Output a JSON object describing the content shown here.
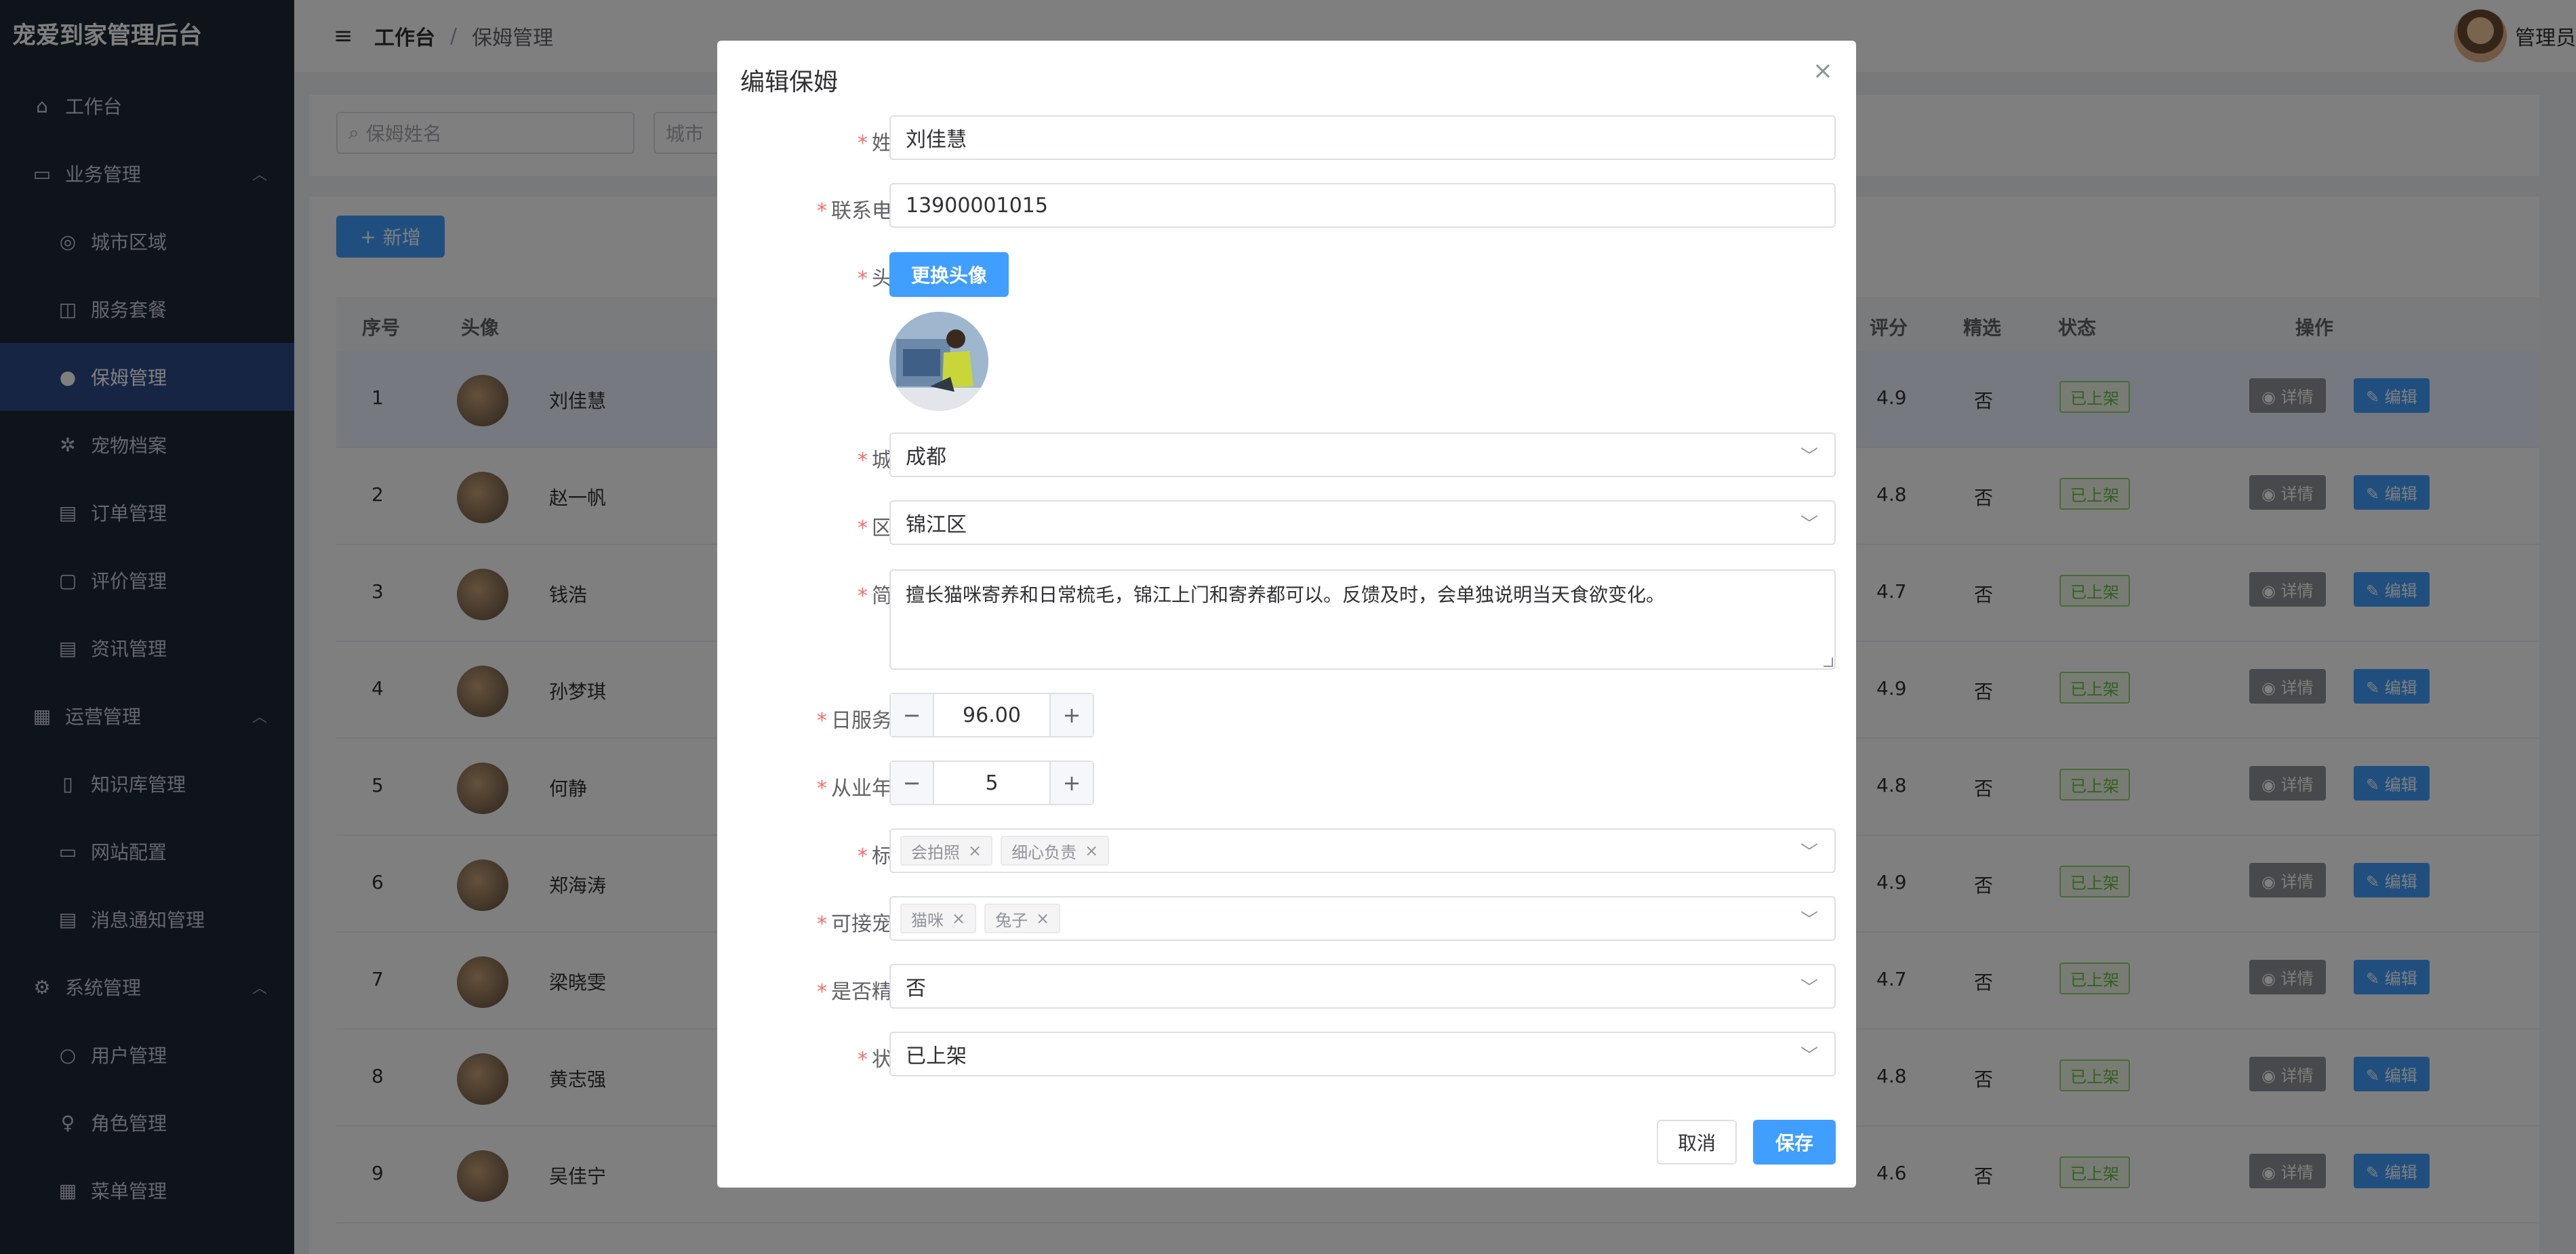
{
  "app": {
    "title": "宠爱到家管理后台"
  },
  "sidebar": {
    "items": [
      {
        "label": "工作台",
        "icon": "home-icon"
      },
      {
        "label": "业务管理",
        "icon": "briefcase-icon"
      },
      {
        "label": "城市区域",
        "icon": "location-icon"
      },
      {
        "label": "服务套餐",
        "icon": "bag-icon"
      },
      {
        "label": "保姆管理",
        "icon": "user-icon"
      },
      {
        "label": "宠物档案",
        "icon": "paw-icon"
      },
      {
        "label": "订单管理",
        "icon": "document-icon"
      },
      {
        "label": "评价管理",
        "icon": "comment-icon"
      },
      {
        "label": "资讯管理",
        "icon": "news-icon"
      },
      {
        "label": "运营管理",
        "icon": "grid-icon"
      },
      {
        "label": "知识库管理",
        "icon": "book-icon"
      },
      {
        "label": "网站配置",
        "icon": "monitor-icon"
      },
      {
        "label": "消息通知管理",
        "icon": "message-icon"
      },
      {
        "label": "系统管理",
        "icon": "gear-icon"
      },
      {
        "label": "用户管理",
        "icon": "user-icon"
      },
      {
        "label": "角色管理",
        "icon": "bulb-icon"
      },
      {
        "label": "菜单管理",
        "icon": "menu-grid-icon"
      }
    ]
  },
  "header": {
    "breadcrumb_1": "工作台",
    "breadcrumb_sep": "/",
    "breadcrumb_2": "保姆管理",
    "user_name": "管理员"
  },
  "filter": {
    "name_placeholder": "保姆姓名",
    "city_placeholder": "城市"
  },
  "toolbar": {
    "add_label": "新增"
  },
  "table": {
    "headers": {
      "index": "序号",
      "avatar": "头像",
      "rating": "评分",
      "featured": "精选",
      "status": "状态",
      "actions": "操作"
    },
    "detail_label": "详情",
    "edit_label": "编辑",
    "rows": [
      {
        "index": "1",
        "name": "刘佳慧",
        "rating": "4.9",
        "featured": "否",
        "status": "已上架"
      },
      {
        "index": "2",
        "name": "赵一帆",
        "rating": "4.8",
        "featured": "否",
        "status": "已上架"
      },
      {
        "index": "3",
        "name": "钱浩",
        "rating": "4.7",
        "featured": "否",
        "status": "已上架"
      },
      {
        "index": "4",
        "name": "孙梦琪",
        "rating": "4.9",
        "featured": "否",
        "status": "已上架"
      },
      {
        "index": "5",
        "name": "何静",
        "rating": "4.8",
        "featured": "否",
        "status": "已上架"
      },
      {
        "index": "6",
        "name": "郑海涛",
        "rating": "4.9",
        "featured": "否",
        "status": "已上架"
      },
      {
        "index": "7",
        "name": "梁晓雯",
        "rating": "4.7",
        "featured": "否",
        "status": "已上架"
      },
      {
        "index": "8",
        "name": "黄志强",
        "rating": "4.8",
        "featured": "否",
        "status": "已上架"
      },
      {
        "index": "9",
        "name": "吴佳宁",
        "rating": "4.6",
        "featured": "否",
        "status": "已上架"
      }
    ]
  },
  "dialog": {
    "title": "编辑保姆",
    "fields": {
      "name": {
        "label": "姓名",
        "value": "刘佳慧"
      },
      "phone": {
        "label": "联系电话",
        "value": "13900001015"
      },
      "avatar": {
        "label": "头像",
        "button": "更换头像"
      },
      "city": {
        "label": "城市",
        "value": "成都"
      },
      "district": {
        "label": "区域",
        "value": "锦江区"
      },
      "intro": {
        "label": "简介",
        "value": "擅长猫咪寄养和日常梳毛，锦江上门和寄养都可以。反馈及时，会单独说明当天食欲变化。"
      },
      "price": {
        "label": "日服务价",
        "value": "96.00"
      },
      "years": {
        "label": "从业年限",
        "value": "5"
      },
      "tags": {
        "label": "标签",
        "values": [
          "会拍照",
          "细心负责"
        ]
      },
      "pets": {
        "label": "可接宠物",
        "values": [
          "猫咪",
          "兔子"
        ]
      },
      "featured": {
        "label": "是否精选",
        "value": "否"
      },
      "status": {
        "label": "状态",
        "value": "已上架"
      }
    },
    "cancel_label": "取消",
    "save_label": "保存"
  },
  "colors": {
    "primary": "#409eff",
    "sidebar_bg": "#1f2937",
    "sidebar_active": "#2f4a8a",
    "required": "#f56c6c"
  }
}
